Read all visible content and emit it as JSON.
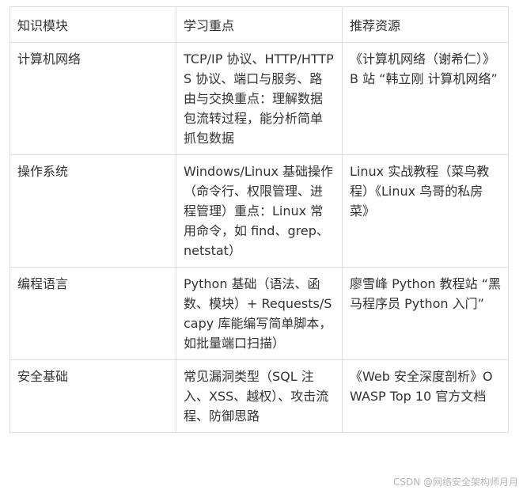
{
  "table": {
    "headers": [
      "知识模块",
      "学习重点",
      "推荐资源"
    ],
    "rows": [
      {
        "module": "计算机网络",
        "focus": "TCP/IP 协议、HTTP/HTTPS 协议、端口与服务、路由与交换重点：理解数据包流转过程，能分析简单抓包数据",
        "resources": "《计算机网络（谢希仁）》B 站 “韩立刚 计算机网络”"
      },
      {
        "module": "操作系统",
        "focus": "Windows/Linux 基础操作（命令行、权限管理、进程管理）重点：Linux 常用命令，如 find、grep、netstat）",
        "resources": "Linux 实战教程（菜鸟教程）《Linux 鸟哥的私房菜》"
      },
      {
        "module": "编程语言",
        "focus": "Python 基础（语法、函数、模块）+ Requests/Scapy 库能编写简单脚本，如批量端口扫描）",
        "resources": "廖雪峰 Python 教程站 “黑马程序员 Python 入门”"
      },
      {
        "module": "安全基础",
        "focus": "常见漏洞类型（SQL 注入、XSS、越权）、攻击流程、防御思路",
        "resources": "《Web 安全深度剖析》OWASP Top 10 官方文档"
      }
    ]
  },
  "watermark": "CSDN @网络安全架构师月月"
}
